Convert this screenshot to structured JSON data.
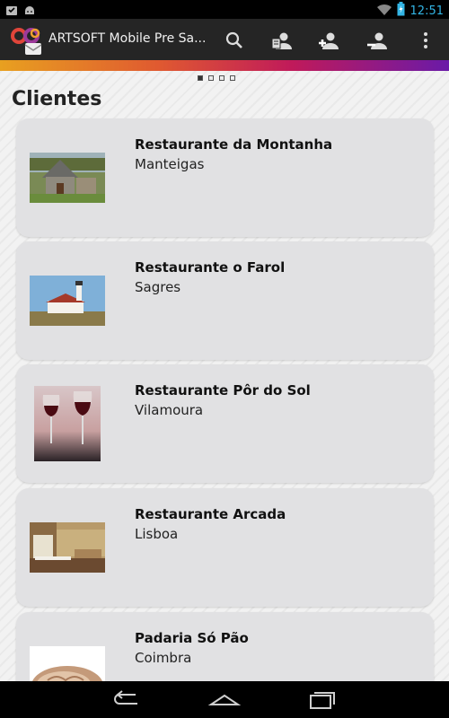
{
  "status_bar": {
    "time": "12:51",
    "icons": [
      "notification-icon",
      "android-icon",
      "wifi-icon",
      "battery-charging-icon"
    ]
  },
  "action_bar": {
    "title": "ARTSOFT Mobile Pre Sa...",
    "icons": [
      "search-icon",
      "client-card-icon",
      "add-person-icon",
      "remove-person-icon",
      "overflow-menu-icon"
    ]
  },
  "pager": {
    "pages": 4,
    "active": 0
  },
  "page_title": "Clientes",
  "clients": [
    {
      "name": "Restaurante da Montanha",
      "city": "Manteigas"
    },
    {
      "name": "Restaurante o Farol",
      "city": "Sagres"
    },
    {
      "name": "Restaurante Pôr do Sol",
      "city": "Vilamoura"
    },
    {
      "name": "Restaurante Arcada",
      "city": "Lisboa"
    },
    {
      "name": "Padaria Só Pão",
      "city": "Coimbra"
    }
  ],
  "navigation": [
    "back-icon",
    "home-icon",
    "recents-icon"
  ],
  "colors": {
    "accent": "#33b5e5",
    "action_bar": "#252525",
    "card": "#e1e1e3"
  }
}
